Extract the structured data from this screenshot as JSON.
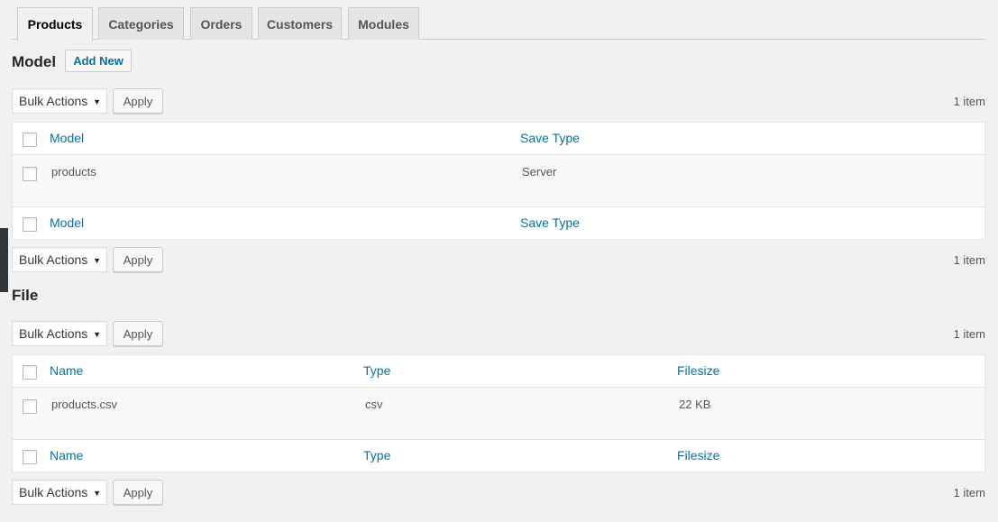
{
  "tabs": [
    {
      "label": "Products",
      "active": true
    },
    {
      "label": "Categories",
      "active": false
    },
    {
      "label": "Orders",
      "active": false
    },
    {
      "label": "Customers",
      "active": false
    },
    {
      "label": "Modules",
      "active": false
    }
  ],
  "model_section": {
    "title": "Model",
    "add_new_label": "Add New",
    "bulk_actions_label": "Bulk Actions",
    "apply_label": "Apply",
    "item_count": "1 item",
    "columns": [
      "Model",
      "Save Type"
    ],
    "rows": [
      {
        "model": "products",
        "save_type": "Server"
      }
    ]
  },
  "file_section": {
    "title": "File",
    "bulk_actions_label": "Bulk Actions",
    "apply_label": "Apply",
    "item_count": "1 item",
    "columns": [
      "Name",
      "Type",
      "Filesize"
    ],
    "rows": [
      {
        "name": "products.csv",
        "type": "csv",
        "filesize": "22 KB"
      }
    ]
  },
  "colors": {
    "link": "#0073aa",
    "background": "#f1f1f1",
    "admin_strip": "#32373c"
  },
  "icons": {
    "select_caret": "caret-down-icon"
  }
}
